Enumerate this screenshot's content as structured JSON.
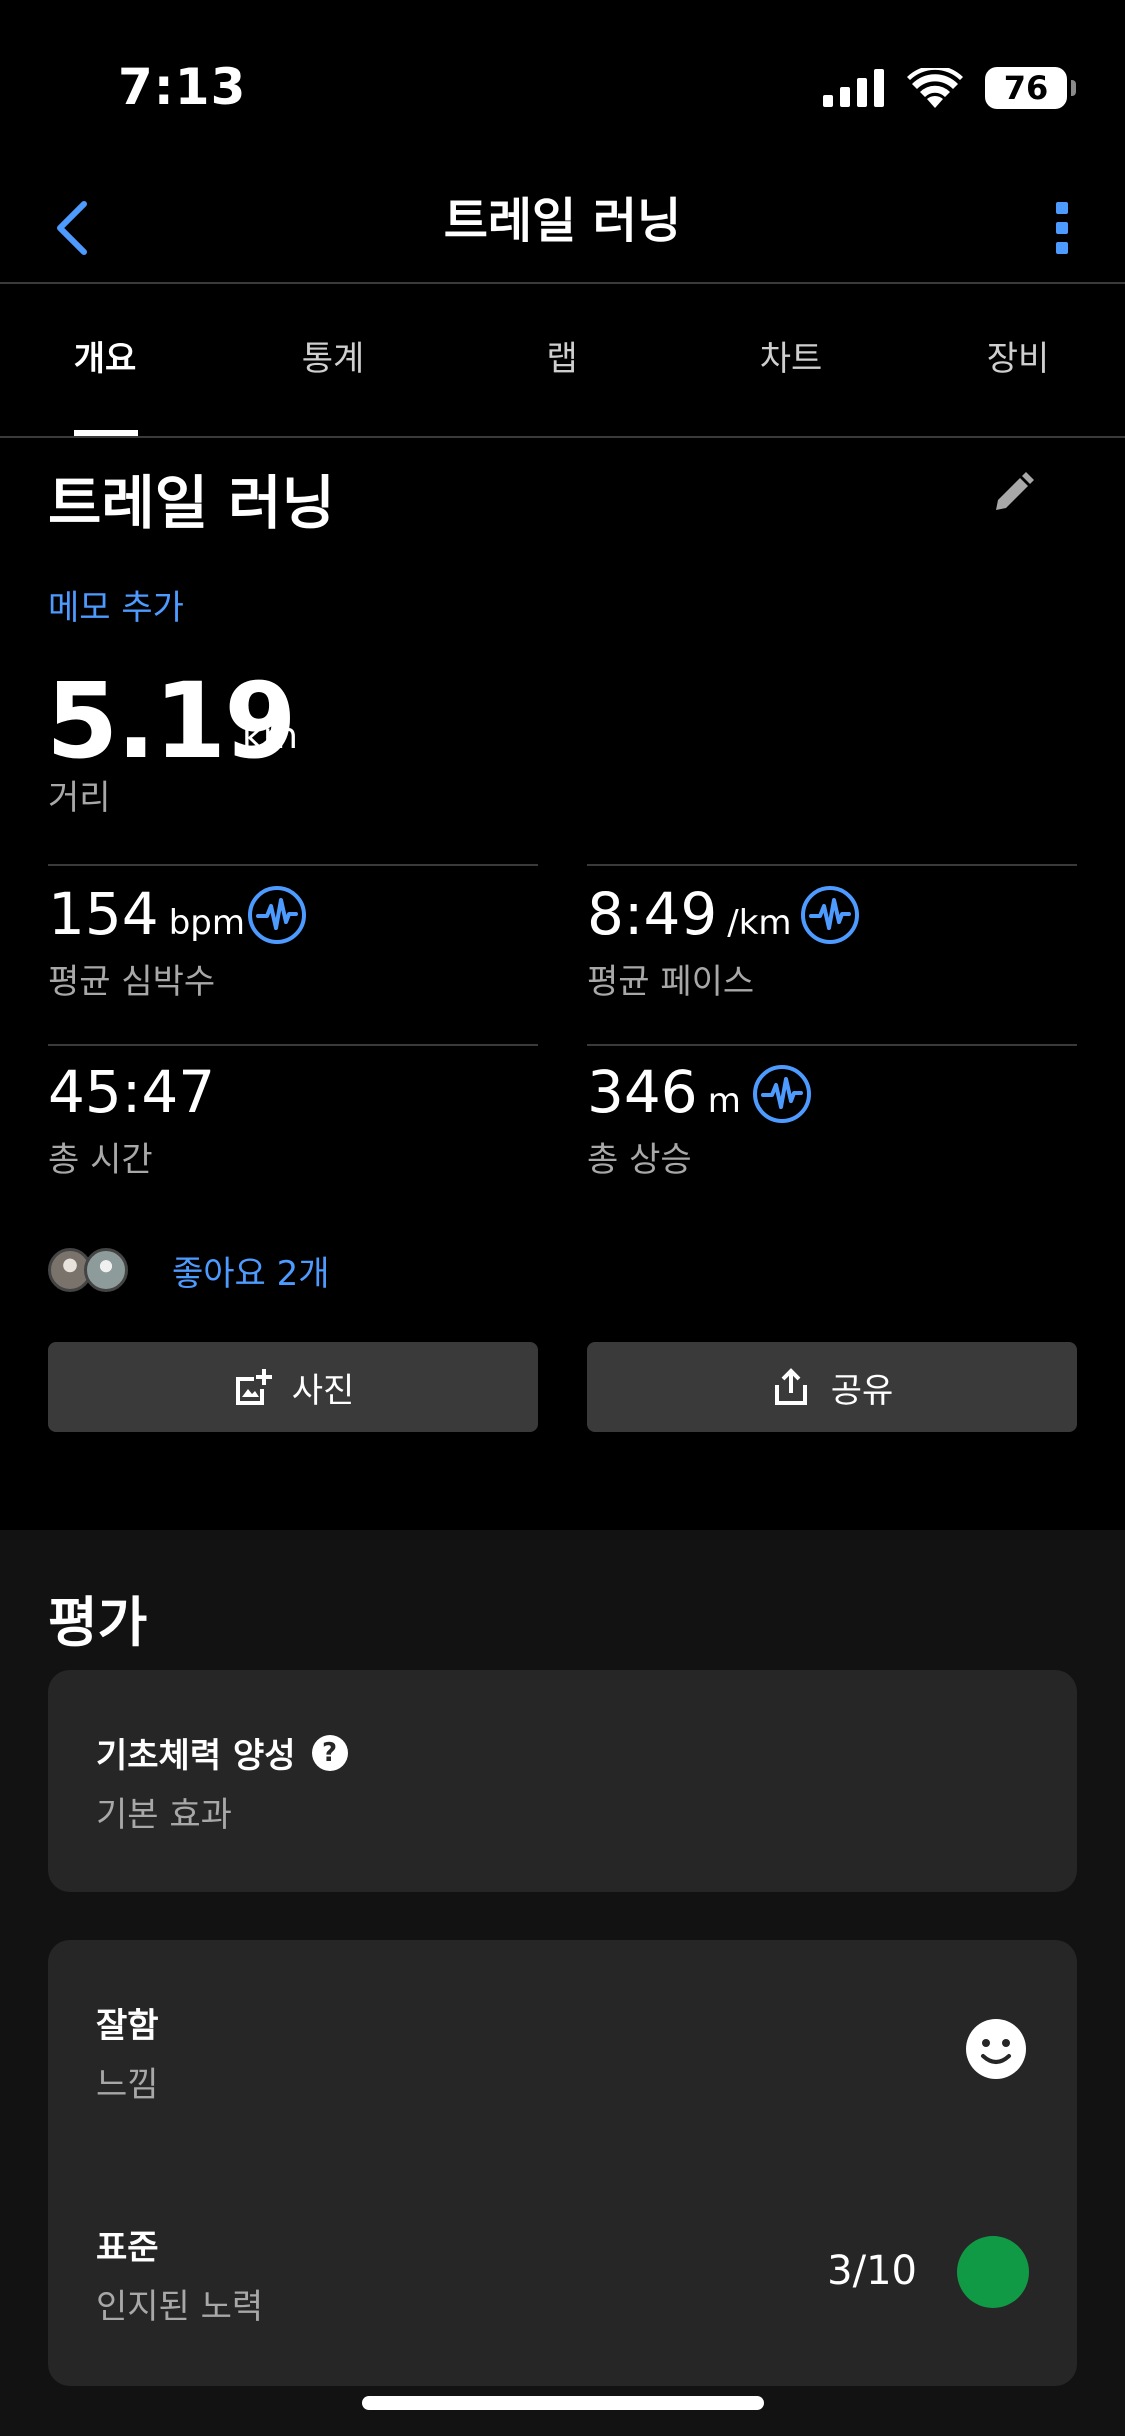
{
  "status_bar": {
    "time": "7:13",
    "battery": "76",
    "icons": [
      "cellular-signal-icon",
      "wifi-icon",
      "battery-icon"
    ]
  },
  "nav": {
    "title": "트레일 러닝",
    "back_icon": "chevron-left-icon",
    "more_icon": "more-vertical-icon",
    "accent_color": "#4e9bff"
  },
  "tabs": [
    {
      "label": "개요",
      "active": true
    },
    {
      "label": "통계",
      "active": false
    },
    {
      "label": "랩",
      "active": false
    },
    {
      "label": "차트",
      "active": false
    },
    {
      "label": "장비",
      "active": false
    }
  ],
  "overview": {
    "activity_title": "트레일 러닝",
    "edit_icon": "pencil-icon",
    "memo_link": "메모 추가",
    "distance": {
      "value": "5.19",
      "unit": "km",
      "label": "거리"
    },
    "stats": [
      {
        "value": "154",
        "unit": "bpm",
        "label": "평균 심박수",
        "icon": "heart-rate-icon"
      },
      {
        "value": "8:49",
        "unit": "/km",
        "label": "평균 페이스",
        "icon": "heart-rate-icon"
      },
      {
        "value": "45:47",
        "unit": "",
        "label": "총 시간",
        "icon": ""
      },
      {
        "value": "346",
        "unit": "m",
        "label": "총 상승",
        "icon": "heart-rate-icon"
      }
    ],
    "likes_text": "좋아요 2개",
    "buttons": {
      "photo": {
        "label": "사진",
        "icon": "add-photo-icon"
      },
      "share": {
        "label": "공유",
        "icon": "share-icon"
      }
    }
  },
  "evaluation": {
    "heading": "평가",
    "training_effect": {
      "title": "기초체력 양성",
      "subtitle": "기본 효과",
      "icon": "help-icon"
    },
    "feel": {
      "title": "잘함",
      "subtitle": "느낌",
      "icon": "smiley-icon"
    },
    "effort": {
      "title": "표준",
      "subtitle": "인지된 노력",
      "value": "3/10",
      "color": "#119a46"
    }
  }
}
